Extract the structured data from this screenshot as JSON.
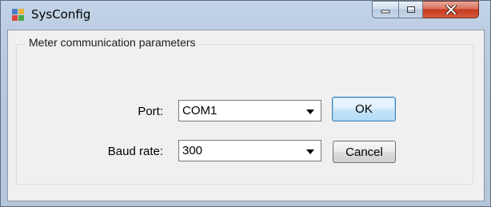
{
  "window": {
    "title": "SysConfig",
    "caption_buttons": [
      "minimize-icon",
      "maximize-icon",
      "close-icon"
    ]
  },
  "group": {
    "title": "Meter communication parameters"
  },
  "port": {
    "label": "Port:",
    "value": "COM1"
  },
  "baud": {
    "label": "Baud rate:",
    "value": "300"
  },
  "buttons": {
    "ok": "OK",
    "cancel": "Cancel"
  },
  "colors": {
    "close_button": "#c4391d",
    "default_button_border": "#3c7fb1"
  }
}
